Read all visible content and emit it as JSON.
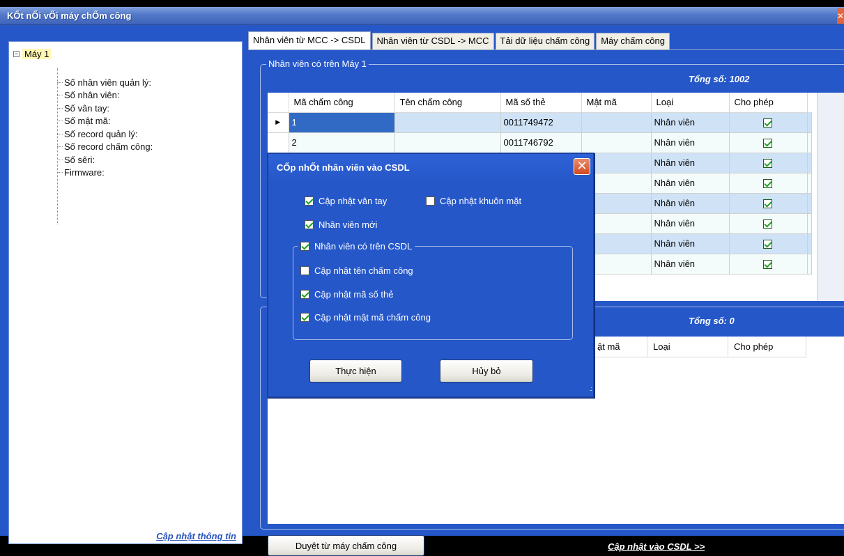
{
  "window": {
    "title": "KŐt nŐi vŐi máy chŐm công",
    "close_glyph": "✕"
  },
  "tree": {
    "root": "Máy 1",
    "expander": "−",
    "items": [
      "Số nhân viên quản lý:",
      "Số nhân viên:",
      "Số vân tay:",
      "Số mật mã:",
      "Số record quản lý:",
      "Số record chấm công:",
      "Số sêri:",
      "Firmware:"
    ]
  },
  "left_panel": {
    "update_info_link": "Cập nhật thông tin"
  },
  "tabs": [
    {
      "label": "Nhân viên từ MCC -> CSDL",
      "active": true
    },
    {
      "label": "Nhân viên từ CSDL -> MCC",
      "active": false
    },
    {
      "label": "Tải dữ liệu chấm công",
      "active": false
    },
    {
      "label": "Máy chấm công",
      "active": false
    }
  ],
  "top_group": {
    "legend": "Nhân viên có trên Máy 1",
    "total": "Tổng số: 1002",
    "columns": [
      "Mã chấm công",
      "Tên chấm công",
      "Mã số thẻ",
      "Mật mã",
      "Loại",
      "Cho phép"
    ],
    "rows": [
      {
        "ma": "1",
        "ten": "",
        "the": "0011749472",
        "matma": "",
        "loai": "Nhân viên",
        "cho_phep": true
      },
      {
        "ma": "2",
        "ten": "",
        "the": "0011746792",
        "matma": "",
        "loai": "Nhân viên",
        "cho_phep": true
      },
      {
        "ma": "",
        "ten": "",
        "the": "",
        "matma": "",
        "loai": "Nhân viên",
        "cho_phep": true
      },
      {
        "ma": "",
        "ten": "",
        "the": "",
        "matma": "",
        "loai": "Nhân viên",
        "cho_phep": true
      },
      {
        "ma": "",
        "ten": "",
        "the": "",
        "matma": "",
        "loai": "Nhân viên",
        "cho_phep": true
      },
      {
        "ma": "",
        "ten": "",
        "the": "",
        "matma": "",
        "loai": "Nhân viên",
        "cho_phep": true
      },
      {
        "ma": "",
        "ten": "",
        "the": "",
        "matma": "",
        "loai": "Nhân viên",
        "cho_phep": true
      },
      {
        "ma": "",
        "ten": "",
        "the": "",
        "matma": "",
        "loai": "Nhân viên",
        "cho_phep": true
      }
    ],
    "row_indicator": "▶"
  },
  "bottom_group": {
    "total": "Tổng số: 0",
    "columns_visible": [
      "ật mã",
      "Loại",
      "Cho phép"
    ]
  },
  "buttons": {
    "browse_device": "Duyệt từ máy chấm công",
    "update_db_link": "Cập nhật vào CSDL >>"
  },
  "dialog": {
    "title": "CŐp nhŐt nhân viên vào CSDL",
    "close_glyph": "✕",
    "opt_fingerprint": {
      "label": "Cập nhật vân tay",
      "checked": true
    },
    "opt_face": {
      "label": "Cập nhật khuôn mặt",
      "checked": false
    },
    "opt_new_employee": {
      "label": "Nhân viên mới",
      "checked": true
    },
    "group_existing": {
      "label": "Nhân viên có trên CSDL",
      "checked": true
    },
    "opt_update_name": {
      "label": "Cập nhật tên chấm công",
      "checked": false
    },
    "opt_update_card": {
      "label": "Cập nhật mã số thẻ",
      "checked": true
    },
    "opt_update_password": {
      "label": "Cập nhật mật mã chấm công",
      "checked": true
    },
    "execute_button": "Thực hiện",
    "cancel_button": "Hủy bỏ",
    "grip_glyph": ".:"
  }
}
